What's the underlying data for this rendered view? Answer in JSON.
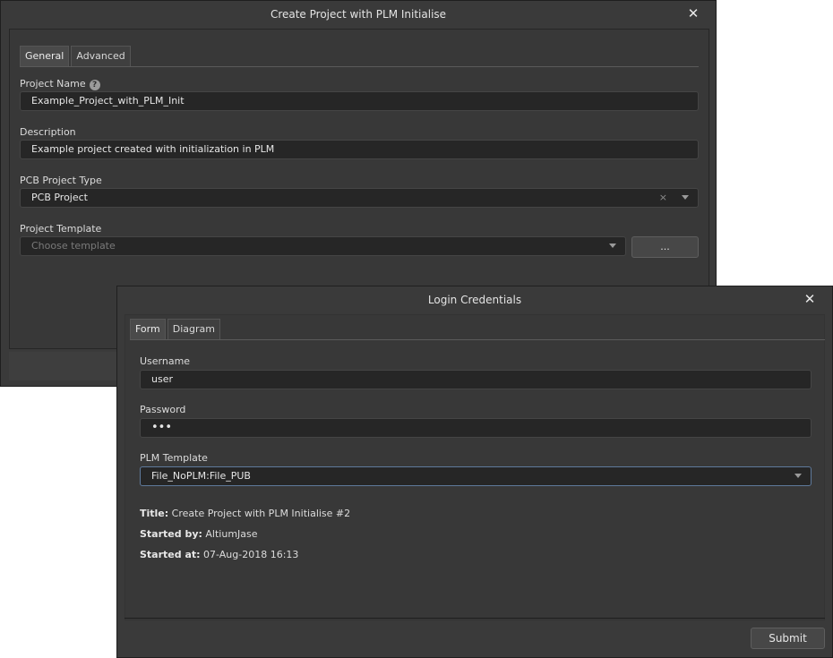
{
  "main_dialog": {
    "title": "Create Project with PLM Initialise",
    "tabs": [
      "General",
      "Advanced"
    ],
    "project_name": {
      "label": "Project Name",
      "value": "Example_Project_with_PLM_Init",
      "help_glyph": "?"
    },
    "description": {
      "label": "Description",
      "value": "Example project created with initialization in PLM"
    },
    "pcb_project_type": {
      "label": "PCB Project Type",
      "value": "PCB Project",
      "clear_glyph": "×"
    },
    "project_template": {
      "label": "Project Template",
      "placeholder": "Choose template",
      "browse_label": "..."
    }
  },
  "login_dialog": {
    "title": "Login Credentials",
    "tabs": [
      "Form",
      "Diagram"
    ],
    "username": {
      "label": "Username",
      "value": "user"
    },
    "password": {
      "label": "Password",
      "value": "•••"
    },
    "plm_template": {
      "label": "PLM Template",
      "value": "File_NoPLM:File_PUB"
    },
    "info": {
      "title_label": "Title:",
      "title_value": "Create Project with PLM Initialise #2",
      "started_by_label": "Started by:",
      "started_by_value": "AltiumJase",
      "started_at_label": "Started at:",
      "started_at_value": "07-Aug-2018 16:13"
    },
    "submit_label": "Submit"
  },
  "icons": {
    "close": "close-icon",
    "dropdown": "chevron-down-icon",
    "help": "help-icon"
  },
  "colors": {
    "dialog_bg": "#3a3a3a",
    "field_bg": "#262626",
    "focus_border": "#5f7a9c"
  }
}
